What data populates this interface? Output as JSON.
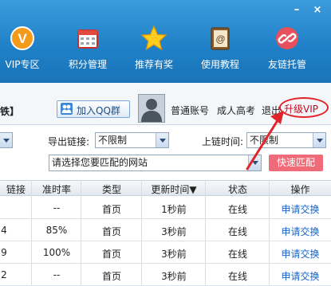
{
  "nav": {
    "items": [
      {
        "label": "VIP专区",
        "icon": "vip-icon"
      },
      {
        "label": "积分管理",
        "icon": "calendar-icon"
      },
      {
        "label": "推荐有奖",
        "icon": "star-icon"
      },
      {
        "label": "使用教程",
        "icon": "book-icon"
      },
      {
        "label": "友链托管",
        "icon": "link-hosting-icon"
      }
    ],
    "window_controls": {
      "minimize": "–",
      "close": "×"
    }
  },
  "account": {
    "left_fragment": "铁】",
    "qq_group_label": "加入QQ群",
    "account_type": "普通账号",
    "username": "成人高考",
    "logout": "退出",
    "upgrade": "升级VIP"
  },
  "filters": {
    "export_link_label": "导出链接:",
    "export_link_value": "不限制",
    "link_time_label": "上链时间:",
    "link_time_value": "不限制",
    "site_placeholder": "请选择您要匹配的网站",
    "quick_match": "快速匹配"
  },
  "table": {
    "headers": [
      "链接",
      "准时率",
      "类型",
      "更新时间▼",
      "状态",
      "操作"
    ],
    "rows": [
      {
        "links": "",
        "rate": "--",
        "type": "首页",
        "updated": "1秒前",
        "status": "在线",
        "action": "申请交换"
      },
      {
        "links": "4",
        "rate": "85%",
        "type": "首页",
        "updated": "3秒前",
        "status": "在线",
        "action": "申请交换"
      },
      {
        "links": "9",
        "rate": "100%",
        "type": "首页",
        "updated": "3秒前",
        "status": "在线",
        "action": "申请交换"
      },
      {
        "links": "2",
        "rate": "--",
        "type": "首页",
        "updated": "3秒前",
        "status": "在线",
        "action": "申请交换"
      }
    ]
  },
  "colors": {
    "accent_blue": "#1f7fc6",
    "highlight_red": "#e0242a",
    "link": "#1a63c6"
  }
}
